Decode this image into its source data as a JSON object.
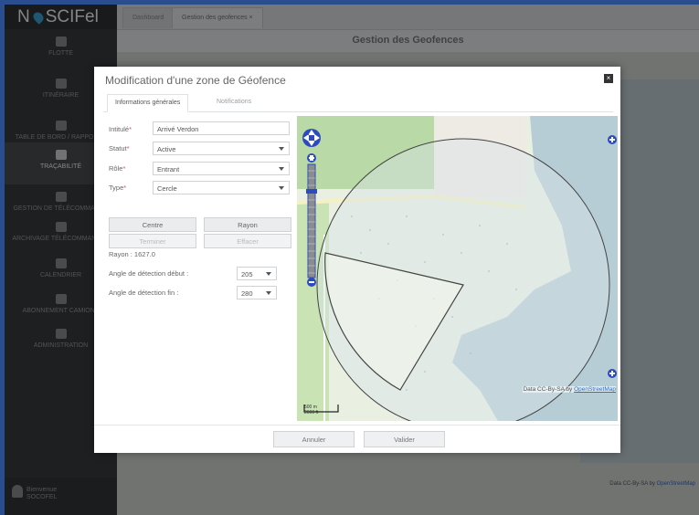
{
  "app": {
    "logo_text": "N",
    "logo_text2": "SCIFel"
  },
  "sidebar": {
    "items": [
      {
        "label": "FLOTTE",
        "active": false
      },
      {
        "label": "ITINÉRAIRE",
        "active": false
      },
      {
        "label": "TABLE DE BORD / RAPPORTS",
        "active": false
      },
      {
        "label": "TRAÇABILITÉ",
        "active": true
      },
      {
        "label": "GESTION DE TÉLÉCOMMANDE",
        "active": false
      },
      {
        "label": "ARCHIVAGE TÉLÉCOMMANDES",
        "active": false
      },
      {
        "label": "CALENDRIER",
        "active": false
      },
      {
        "label": "ABONNEMENT CAMIONS",
        "active": false
      },
      {
        "label": "ADMINISTRATION",
        "active": false
      }
    ],
    "user": {
      "line1": "Bienvenue",
      "line2": "SOCOFEL"
    }
  },
  "topbar": {
    "tabs": [
      {
        "label": "Dashboard"
      },
      {
        "label": "Gestion des geofences ×"
      }
    ]
  },
  "page": {
    "title": "Gestion des Geofences"
  },
  "background_map": {
    "attribution_prefix": "Data CC-By-SA by ",
    "attribution_link": "OpenStreetMap"
  },
  "modal": {
    "title": "Modification d'une zone de Géofence",
    "close_symbol": "×",
    "tabs": [
      {
        "label": "Informations générales",
        "active": true
      },
      {
        "label": "Notifications",
        "active": false
      }
    ],
    "form": {
      "required_mark": "*",
      "intitule": {
        "label": "Intitulé",
        "value": "Arrivé Verdon"
      },
      "statut": {
        "label": "Statut",
        "value": "Active"
      },
      "role": {
        "label": "Rôle",
        "value": "Entrant"
      },
      "type": {
        "label": "Type",
        "value": "Cercle"
      },
      "buttons": {
        "centre": "Centre",
        "rayon": "Rayon",
        "terminer": "Terminer",
        "effacer": "Effacer"
      },
      "rayon_text": "Rayon : 1627.0",
      "angle_debut": {
        "label": "Angle de détection début :",
        "value": "205"
      },
      "angle_fin": {
        "label": "Angle de détection fin :",
        "value": "280"
      }
    },
    "map": {
      "attribution_prefix": "Data CC-By-SA by ",
      "attribution_link": "OpenStreetMap",
      "scale_m": "500 m",
      "scale_ft": "2000 ft"
    },
    "footer": {
      "annuler": "Annuler",
      "valider": "Valider"
    }
  },
  "colors": {
    "sidebar": "#3a3d40",
    "accent": "#3ea6d8",
    "zoom_bar": "#2d4bbf",
    "required": "#d9534f"
  }
}
